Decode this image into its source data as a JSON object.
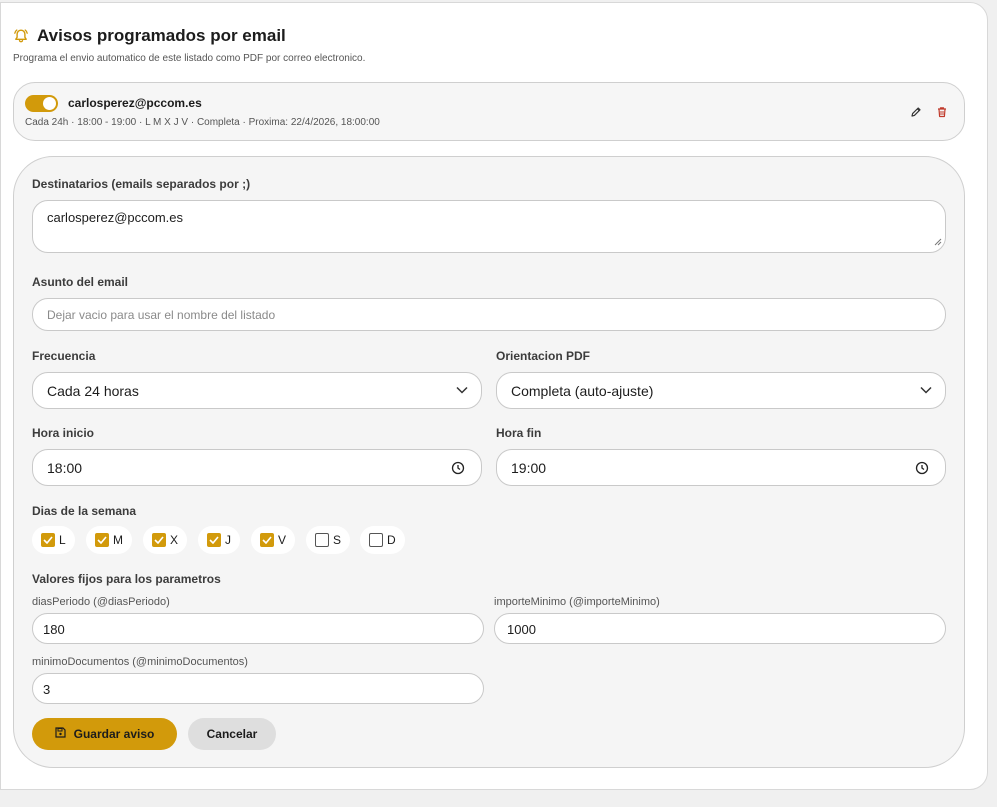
{
  "header": {
    "title": "Avisos programados por email",
    "subtitle": "Programa el envio automatico de este listado como PDF por correo electronico.",
    "icon": "bell-icon"
  },
  "summary": {
    "enabled": true,
    "email": "carlosperez@pccom.es",
    "details": "Cada 24h · 18:00 - 19:00 · L M X J V · Completa · Proxima: 22/4/2026, 18:00:00",
    "edit_icon": "pencil-icon",
    "delete_icon": "trash-icon"
  },
  "form": {
    "recipients_label": "Destinatarios (emails separados por ;)",
    "recipients_value": "carlosperez@pccom.es",
    "subject_label": "Asunto del email",
    "subject_placeholder": "Dejar vacio para usar el nombre del listado",
    "frequency_label": "Frecuencia",
    "frequency_value": "Cada 24 horas",
    "orientation_label": "Orientacion PDF",
    "orientation_value": "Completa (auto-ajuste)",
    "start_label": "Hora inicio",
    "start_value": "18:00",
    "end_label": "Hora fin",
    "end_value": "19:00",
    "days_label": "Dias de la semana",
    "days": [
      {
        "label": "L",
        "checked": true
      },
      {
        "label": "M",
        "checked": true
      },
      {
        "label": "X",
        "checked": true
      },
      {
        "label": "J",
        "checked": true
      },
      {
        "label": "V",
        "checked": true
      },
      {
        "label": "S",
        "checked": false
      },
      {
        "label": "D",
        "checked": false
      }
    ],
    "params_label": "Valores fijos para los parametros",
    "params": [
      {
        "label": "diasPeriodo (@diasPeriodo)",
        "value": "180"
      },
      {
        "label": "importeMinimo (@importeMinimo)",
        "value": "1000"
      },
      {
        "label": "minimoDocumentos (@minimoDocumentos)",
        "value": "3"
      }
    ],
    "save_label": "Guardar aviso",
    "cancel_label": "Cancelar"
  },
  "colors": {
    "accent": "#d29a0b",
    "delete": "#c0392b"
  }
}
